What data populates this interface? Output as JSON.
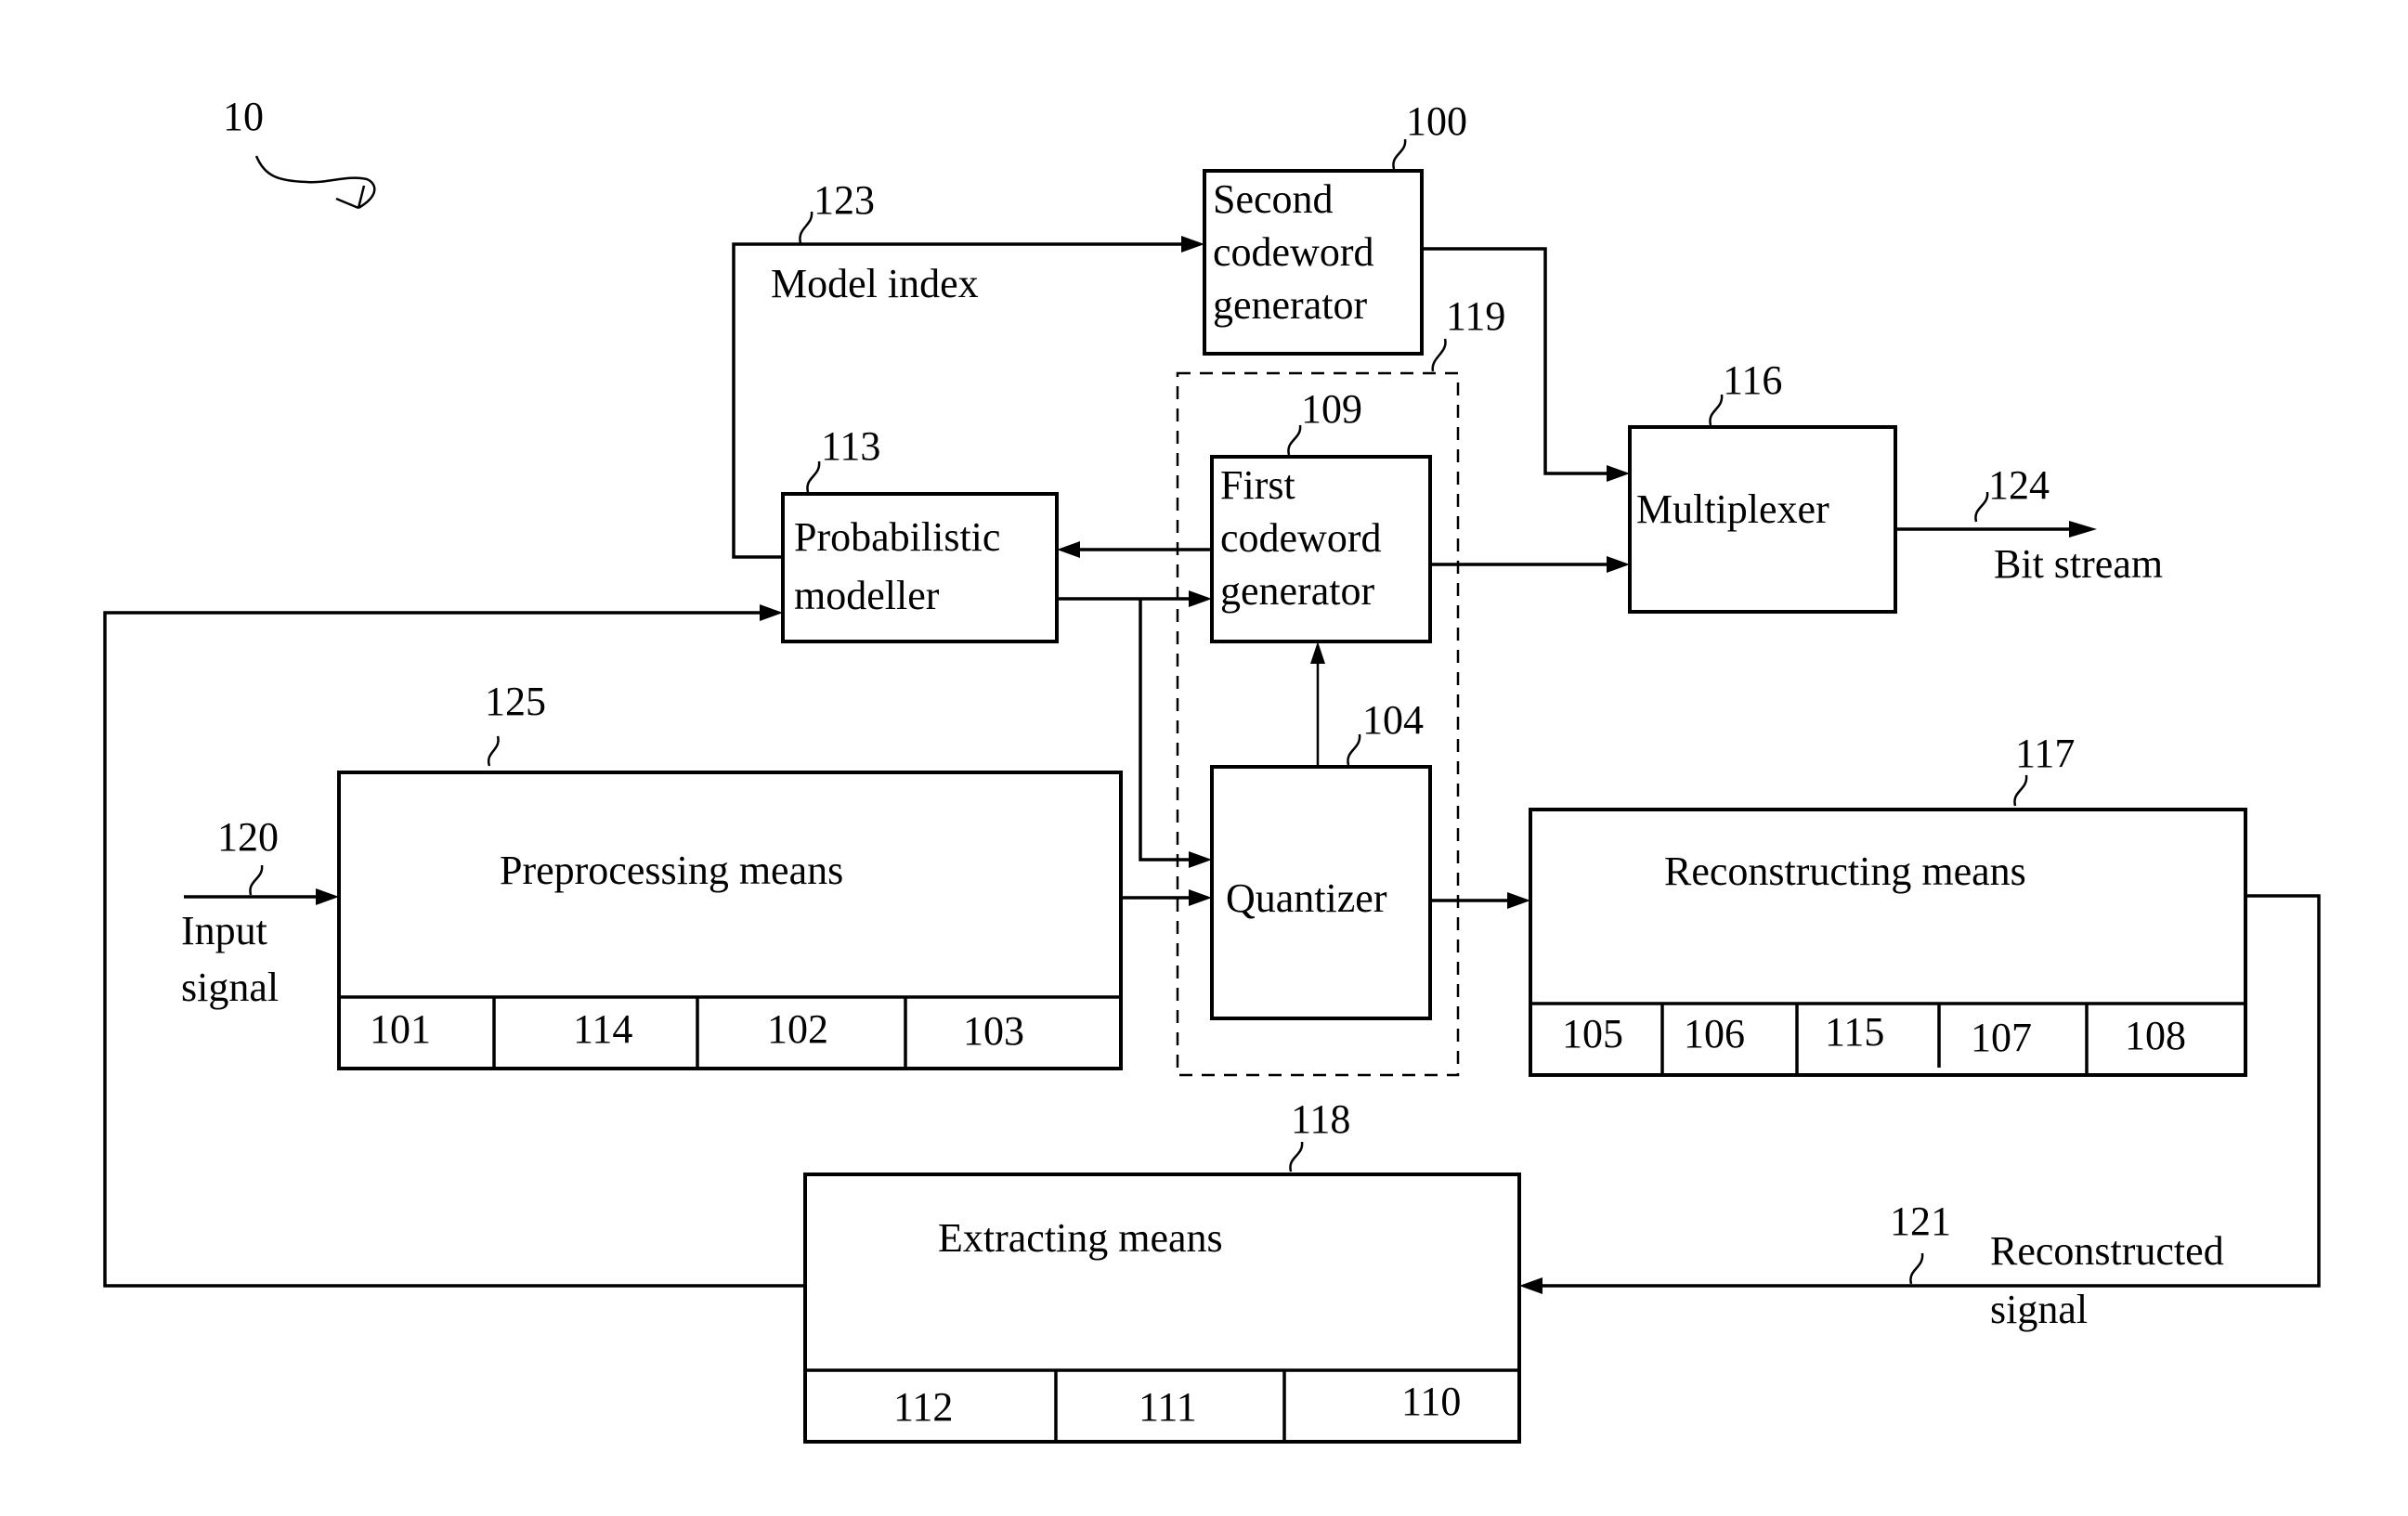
{
  "figure": {
    "reference": "10"
  },
  "blocks": {
    "second_codeword": {
      "ref": "100",
      "lines": [
        "Second",
        "codeword",
        "generator"
      ]
    },
    "first_codeword": {
      "ref": "109",
      "lines": [
        "First",
        "codeword",
        "generator"
      ]
    },
    "probabilistic_modeller": {
      "ref": "113",
      "lines": [
        "Probabilistic",
        "modeller"
      ]
    },
    "multiplexer": {
      "ref": "116",
      "lines": [
        "Multiplexer"
      ]
    },
    "quantizer": {
      "ref": "104",
      "lines": [
        "Quantizer"
      ]
    },
    "encoder_group": {
      "ref": "119"
    },
    "preprocessing": {
      "ref": "125",
      "title": "Preprocessing means",
      "cells": [
        "101",
        "114",
        "102",
        "103"
      ]
    },
    "reconstructing": {
      "ref": "117",
      "title": "Reconstructing means",
      "cells": [
        "105",
        "106",
        "115",
        "107",
        "108"
      ]
    },
    "extracting": {
      "ref": "118",
      "title": "Extracting means",
      "cells": [
        "112",
        "111",
        "110"
      ]
    }
  },
  "signals": {
    "model_index": {
      "ref": "123",
      "label": "Model index"
    },
    "bit_stream": {
      "ref": "124",
      "label": "Bit stream"
    },
    "input_signal": {
      "ref": "120",
      "lines": [
        "Input",
        "signal"
      ]
    },
    "reconstructed_signal": {
      "ref": "121",
      "lines": [
        "Reconstructed",
        "signal"
      ]
    }
  }
}
